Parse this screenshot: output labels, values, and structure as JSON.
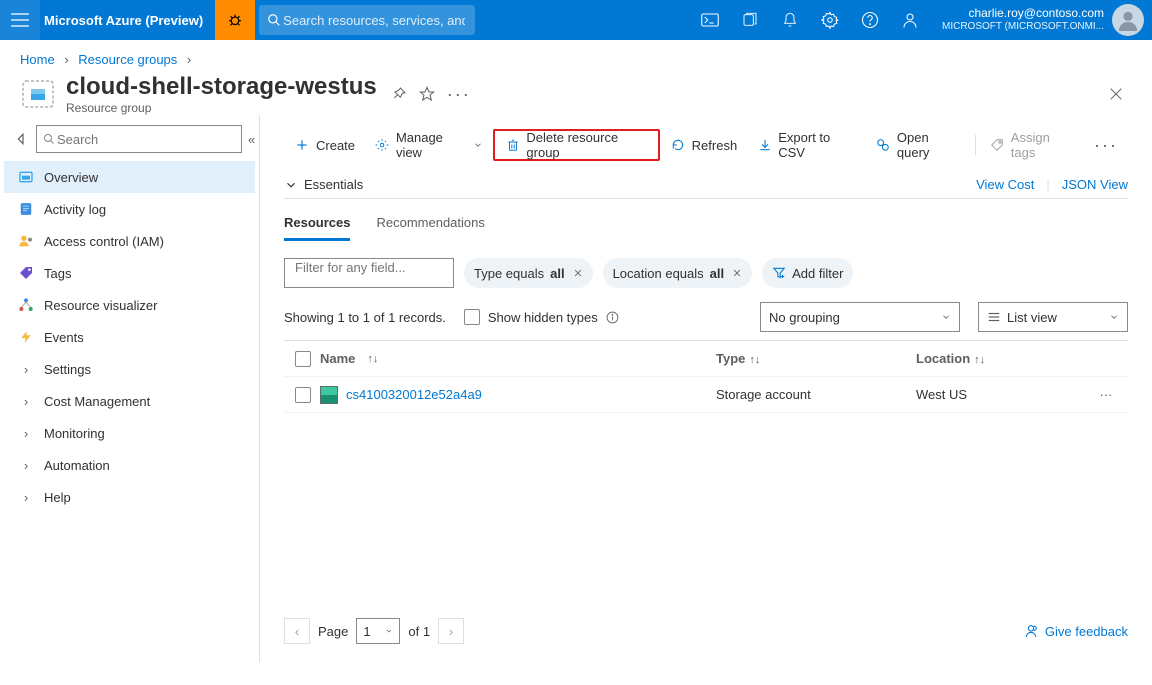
{
  "topbar": {
    "brand": "Microsoft Azure (Preview)",
    "search_placeholder": "Search resources, services, and docs (G+/)",
    "account_email": "charlie.roy@contoso.com",
    "account_tenant": "MICROSOFT (MICROSOFT.ONMI..."
  },
  "breadcrumb": {
    "items": [
      "Home",
      "Resource groups"
    ]
  },
  "title": {
    "name": "cloud-shell-storage-westus",
    "subtitle": "Resource group"
  },
  "sidebar": {
    "search_placeholder": "Search",
    "items": [
      {
        "label": "Overview",
        "kind": "overview",
        "selected": true
      },
      {
        "label": "Activity log",
        "kind": "activitylog"
      },
      {
        "label": "Access control (IAM)",
        "kind": "iam"
      },
      {
        "label": "Tags",
        "kind": "tags"
      },
      {
        "label": "Resource visualizer",
        "kind": "visualizer"
      },
      {
        "label": "Events",
        "kind": "events"
      },
      {
        "label": "Settings",
        "kind": "settings",
        "chevron": true
      },
      {
        "label": "Cost Management",
        "kind": "cost",
        "chevron": true
      },
      {
        "label": "Monitoring",
        "kind": "monitoring",
        "chevron": true
      },
      {
        "label": "Automation",
        "kind": "automation",
        "chevron": true
      },
      {
        "label": "Help",
        "kind": "help",
        "chevron": true
      }
    ]
  },
  "commands": {
    "create": "Create",
    "manage_view": "Manage view",
    "delete_rg": "Delete resource group",
    "refresh": "Refresh",
    "export_csv": "Export to CSV",
    "open_query": "Open query",
    "assign_tags": "Assign tags"
  },
  "essentials": {
    "label": "Essentials",
    "view_cost": "View Cost",
    "json_view": "JSON View"
  },
  "tabs": {
    "resources": "Resources",
    "recommendations": "Recommendations"
  },
  "filters": {
    "placeholder": "Filter for any field...",
    "type_prefix": "Type equals ",
    "type_value": "all",
    "loc_prefix": "Location equals ",
    "loc_value": "all",
    "add": "Add filter"
  },
  "midrow": {
    "record_count": "Showing 1 to 1 of 1 records.",
    "hidden_types": "Show hidden types",
    "grouping": "No grouping",
    "list_view": "List view"
  },
  "table": {
    "headers": {
      "name": "Name",
      "type": "Type",
      "location": "Location"
    },
    "rows": [
      {
        "name": "cs4100320012e52a4a9",
        "type": "Storage account",
        "location": "West US"
      }
    ]
  },
  "pager": {
    "page_label": "Page",
    "page": "1",
    "of": "of 1",
    "feedback": "Give feedback"
  }
}
